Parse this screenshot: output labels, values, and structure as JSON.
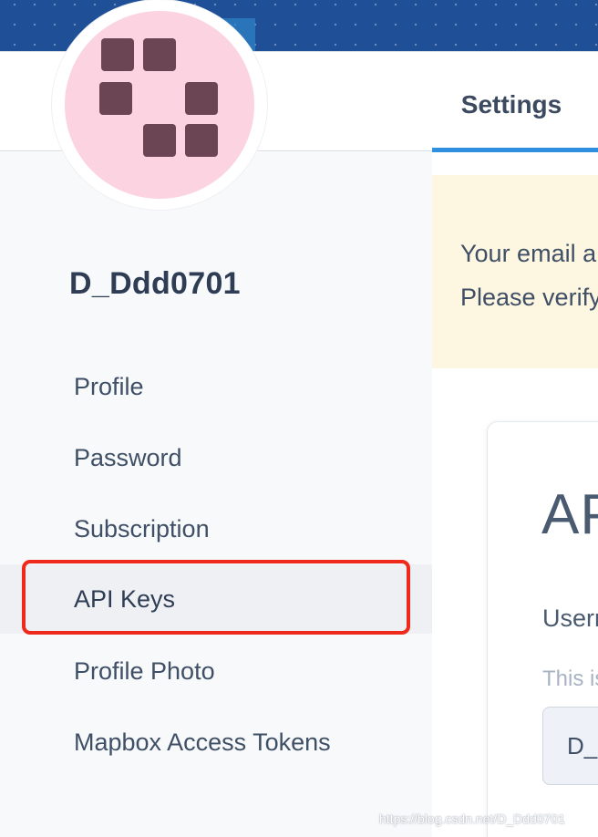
{
  "header": {
    "tabs": [
      {
        "label": "Settings",
        "active": true
      }
    ]
  },
  "profile": {
    "username": "D_Ddd0701"
  },
  "sidebar": {
    "items": [
      {
        "label": "Profile",
        "active": false
      },
      {
        "label": "Password",
        "active": false
      },
      {
        "label": "Subscription",
        "active": false
      },
      {
        "label": "API Keys",
        "active": true
      },
      {
        "label": "Profile Photo",
        "active": false
      },
      {
        "label": "Mapbox Access Tokens",
        "active": false
      }
    ]
  },
  "notice": {
    "line1": "Your email a",
    "line2": "Please verify"
  },
  "card": {
    "title": "AP",
    "username_label": "Userr",
    "hint": "This is",
    "username_value": "D_I"
  },
  "watermark": "https://blog.csdn.net/D_Ddd0701",
  "colors": {
    "banner": "#1f4f97",
    "tab_underline": "#2f90e0",
    "highlight": "#ee2a1c",
    "notice_bg": "#fdf6e1",
    "avatar_bg": "#fbd3e1",
    "avatar_blocks": "#6c4555"
  }
}
